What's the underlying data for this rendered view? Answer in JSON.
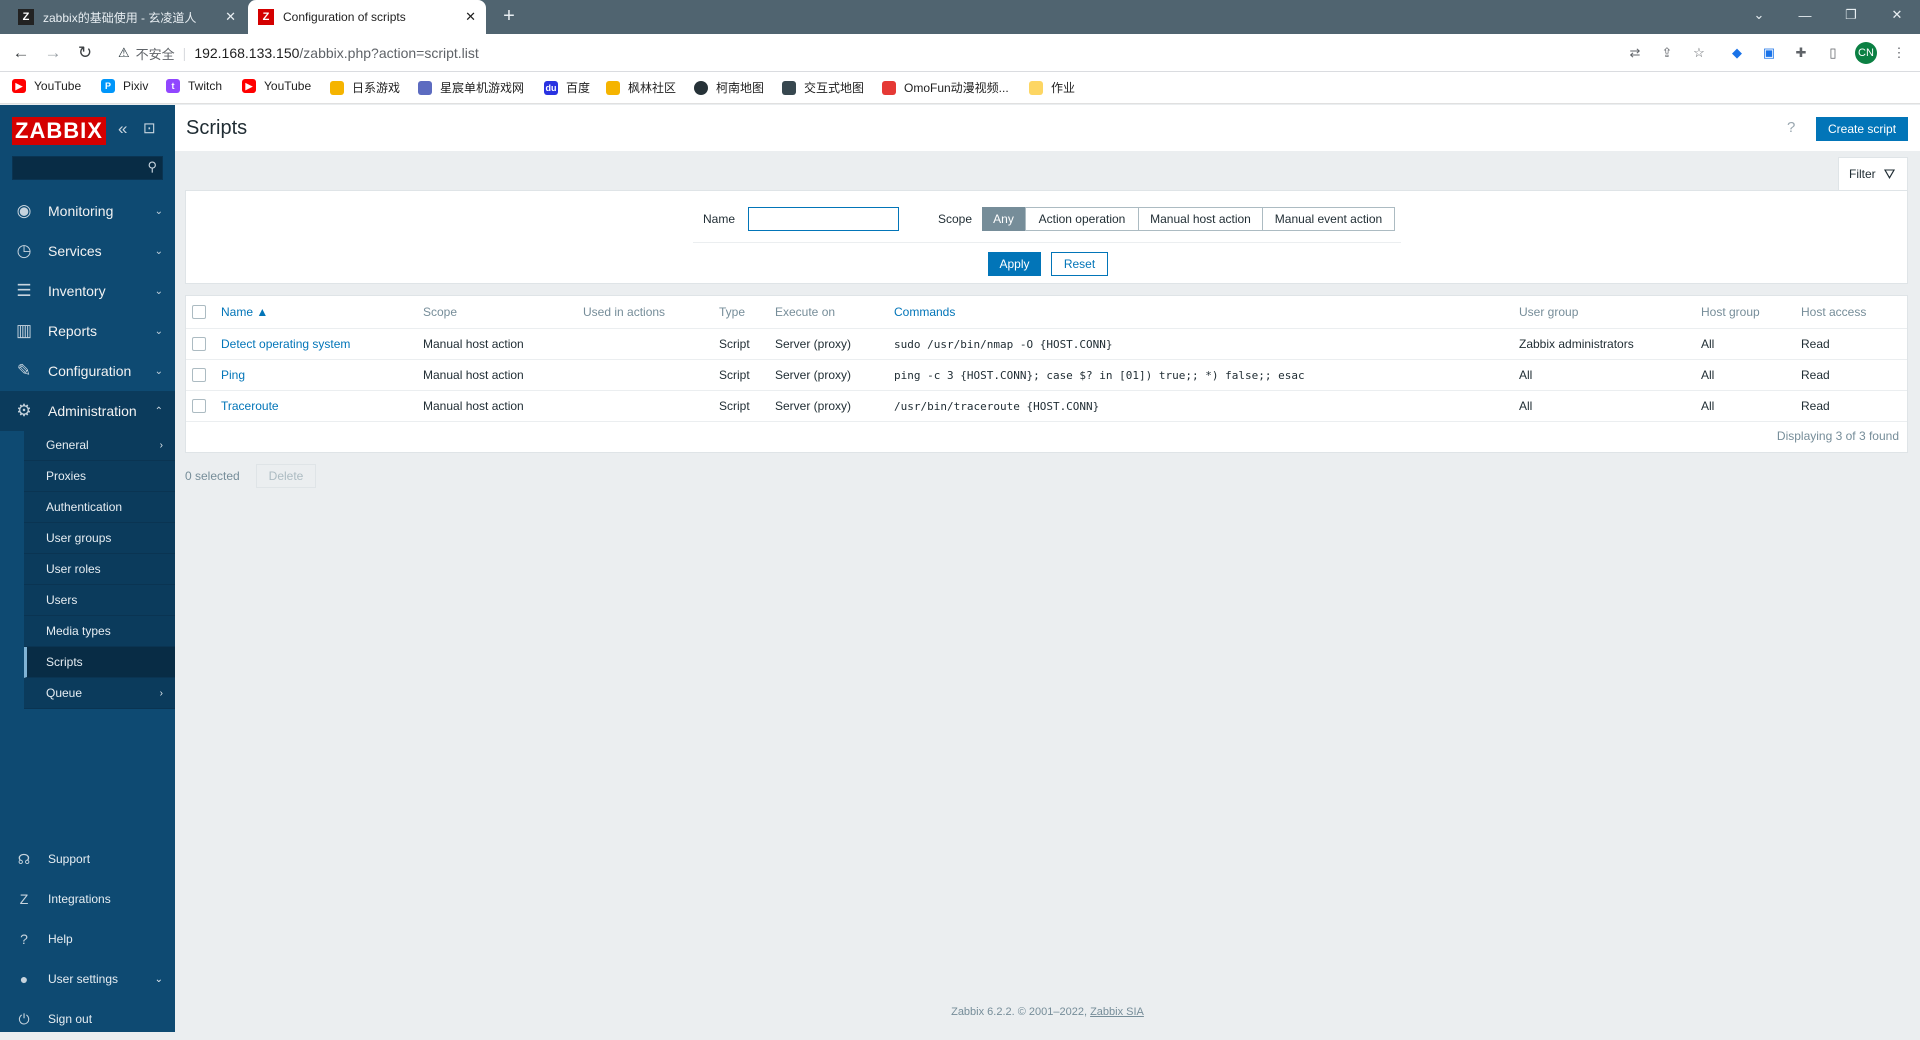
{
  "browser": {
    "tabs": [
      {
        "title": "zabbix的基础使用 - 玄凌道人",
        "icon": "zhihu-favicon"
      },
      {
        "title": "Configuration of scripts",
        "icon": "zabbix-favicon"
      }
    ],
    "address": {
      "security": "不安全",
      "url_host": "192.168.133.150",
      "url_path": "/zabbix.php?action=script.list"
    },
    "profile": "CN",
    "bookmarks": [
      "YouTube",
      "Pixiv",
      "Twitch",
      "YouTube",
      "日系游戏",
      "星宸单机游戏网",
      "百度",
      "枫林社区",
      "柯南地图",
      "交互式地图",
      "OmoFun动漫视频...",
      "作业"
    ]
  },
  "sidebar": {
    "logo": "ZABBIX",
    "menu": [
      "Monitoring",
      "Services",
      "Inventory",
      "Reports",
      "Configuration",
      "Administration"
    ],
    "admin_submenu": [
      "General",
      "Proxies",
      "Authentication",
      "User groups",
      "User roles",
      "Users",
      "Media types",
      "Scripts",
      "Queue"
    ],
    "footer": [
      "Support",
      "Integrations",
      "Help",
      "User settings",
      "Sign out"
    ]
  },
  "page": {
    "title": "Scripts",
    "help": "?",
    "create_button": "Create script",
    "filter_tab": "Filter"
  },
  "filter": {
    "name_label": "Name",
    "name_value": "",
    "scope_label": "Scope",
    "scope_options": [
      "Any",
      "Action operation",
      "Manual host action",
      "Manual event action"
    ],
    "scope_selected": "Any",
    "apply": "Apply",
    "reset": "Reset"
  },
  "table": {
    "columns": [
      "Name ▲",
      "Scope",
      "Used in actions",
      "Type",
      "Execute on",
      "Commands",
      "User group",
      "Host group",
      "Host access"
    ],
    "rows": [
      {
        "name": "Detect operating system",
        "scope": "Manual host action",
        "used": "",
        "type": "Script",
        "execute_on": "Server (proxy)",
        "command": "sudo /usr/bin/nmap -O {HOST.CONN}",
        "user_group": "Zabbix administrators",
        "host_group": "All",
        "host_access": "Read"
      },
      {
        "name": "Ping",
        "scope": "Manual host action",
        "used": "",
        "type": "Script",
        "execute_on": "Server (proxy)",
        "command": "ping -c 3 {HOST.CONN}; case $? in [01]) true;; *) false;; esac",
        "user_group": "All",
        "host_group": "All",
        "host_access": "Read"
      },
      {
        "name": "Traceroute",
        "scope": "Manual host action",
        "used": "",
        "type": "Script",
        "execute_on": "Server (proxy)",
        "command": "/usr/bin/traceroute {HOST.CONN}",
        "user_group": "All",
        "host_group": "All",
        "host_access": "Read"
      }
    ],
    "displaying": "Displaying 3 of 3 found"
  },
  "actions": {
    "selected": "0 selected",
    "delete": "Delete"
  },
  "footer": {
    "text": "Zabbix 6.2.2. © 2001–2022, ",
    "link": "Zabbix SIA"
  }
}
